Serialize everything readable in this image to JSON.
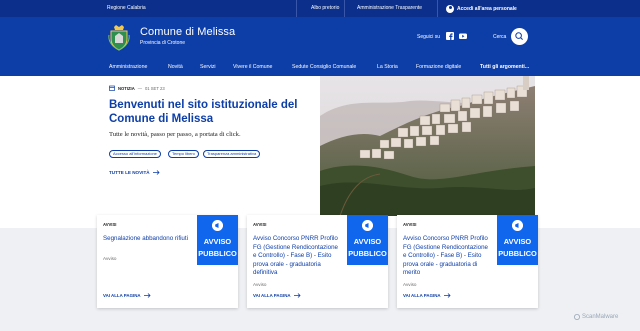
{
  "slim_header": {
    "region": "Regione Calabria",
    "links": [
      "Albo pretorio",
      "Amministrazione Trasparente"
    ],
    "login": "Accedi all'area personale"
  },
  "header": {
    "site_name": "Comune di Melissa",
    "province": "Provincia di Crotone",
    "follow_label": "Seguici su",
    "search_label": "Cerca"
  },
  "nav": {
    "items": [
      "Amministrazione",
      "Novità",
      "Servizi",
      "Vivere il Comune",
      "Sedute Consiglio Comunale",
      "La Storia",
      "Formazione digitale"
    ],
    "all_topics": "Tutti gli argomenti..."
  },
  "hero": {
    "category": "NOTIZIA",
    "date": "01 SET 23",
    "title": "Benvenuti nel sito istituzionale del Comune di Melissa",
    "subtitle": "Tutte le novità, passo per passo, a portata di click.",
    "chips": [
      "Accesso all'informazione",
      "Tempo libero",
      "Trasparenza amministrativa"
    ],
    "all_news": "TUTTE LE NOVITÀ"
  },
  "cards": [
    {
      "category": "AVVISI",
      "title": "Segnalazione abbandono rifiuti",
      "label": "Avviso",
      "more": "VAI ALLA PAGINA",
      "badge_line1": "AVVISO",
      "badge_line2": "PUBBLICO"
    },
    {
      "category": "AVVISI",
      "title": "Avviso Concorso PNRR Profilo FG (Gestione Rendicontazione e Controllo) - Fase B) - Esito prova orale - graduatoria definitiva",
      "label": "Avviso",
      "more": "VAI ALLA PAGINA",
      "badge_line1": "AVVISO",
      "badge_line2": "PUBBLICO"
    },
    {
      "category": "AVVISI",
      "title": "Avviso Concorso PNRR Profilo FG (Gestione Rendicontazione e Controllo) - Fase B) - Esito prova orale - graduatoria di merito",
      "label": "Avviso",
      "more": "VAI ALLA PAGINA",
      "badge_line1": "AVVISO",
      "badge_line2": "PUBBLICO"
    }
  ],
  "watermark": "ScanMalware",
  "colors": {
    "primary": "#0d3ea8",
    "slim_bar": "#0b2f8a",
    "badge": "#1166ee",
    "band": "#eef0f3"
  },
  "icons": [
    "calendar-icon",
    "facebook-icon",
    "youtube-icon",
    "search-icon",
    "user-icon",
    "arrow-right-icon",
    "announcement-icon"
  ]
}
